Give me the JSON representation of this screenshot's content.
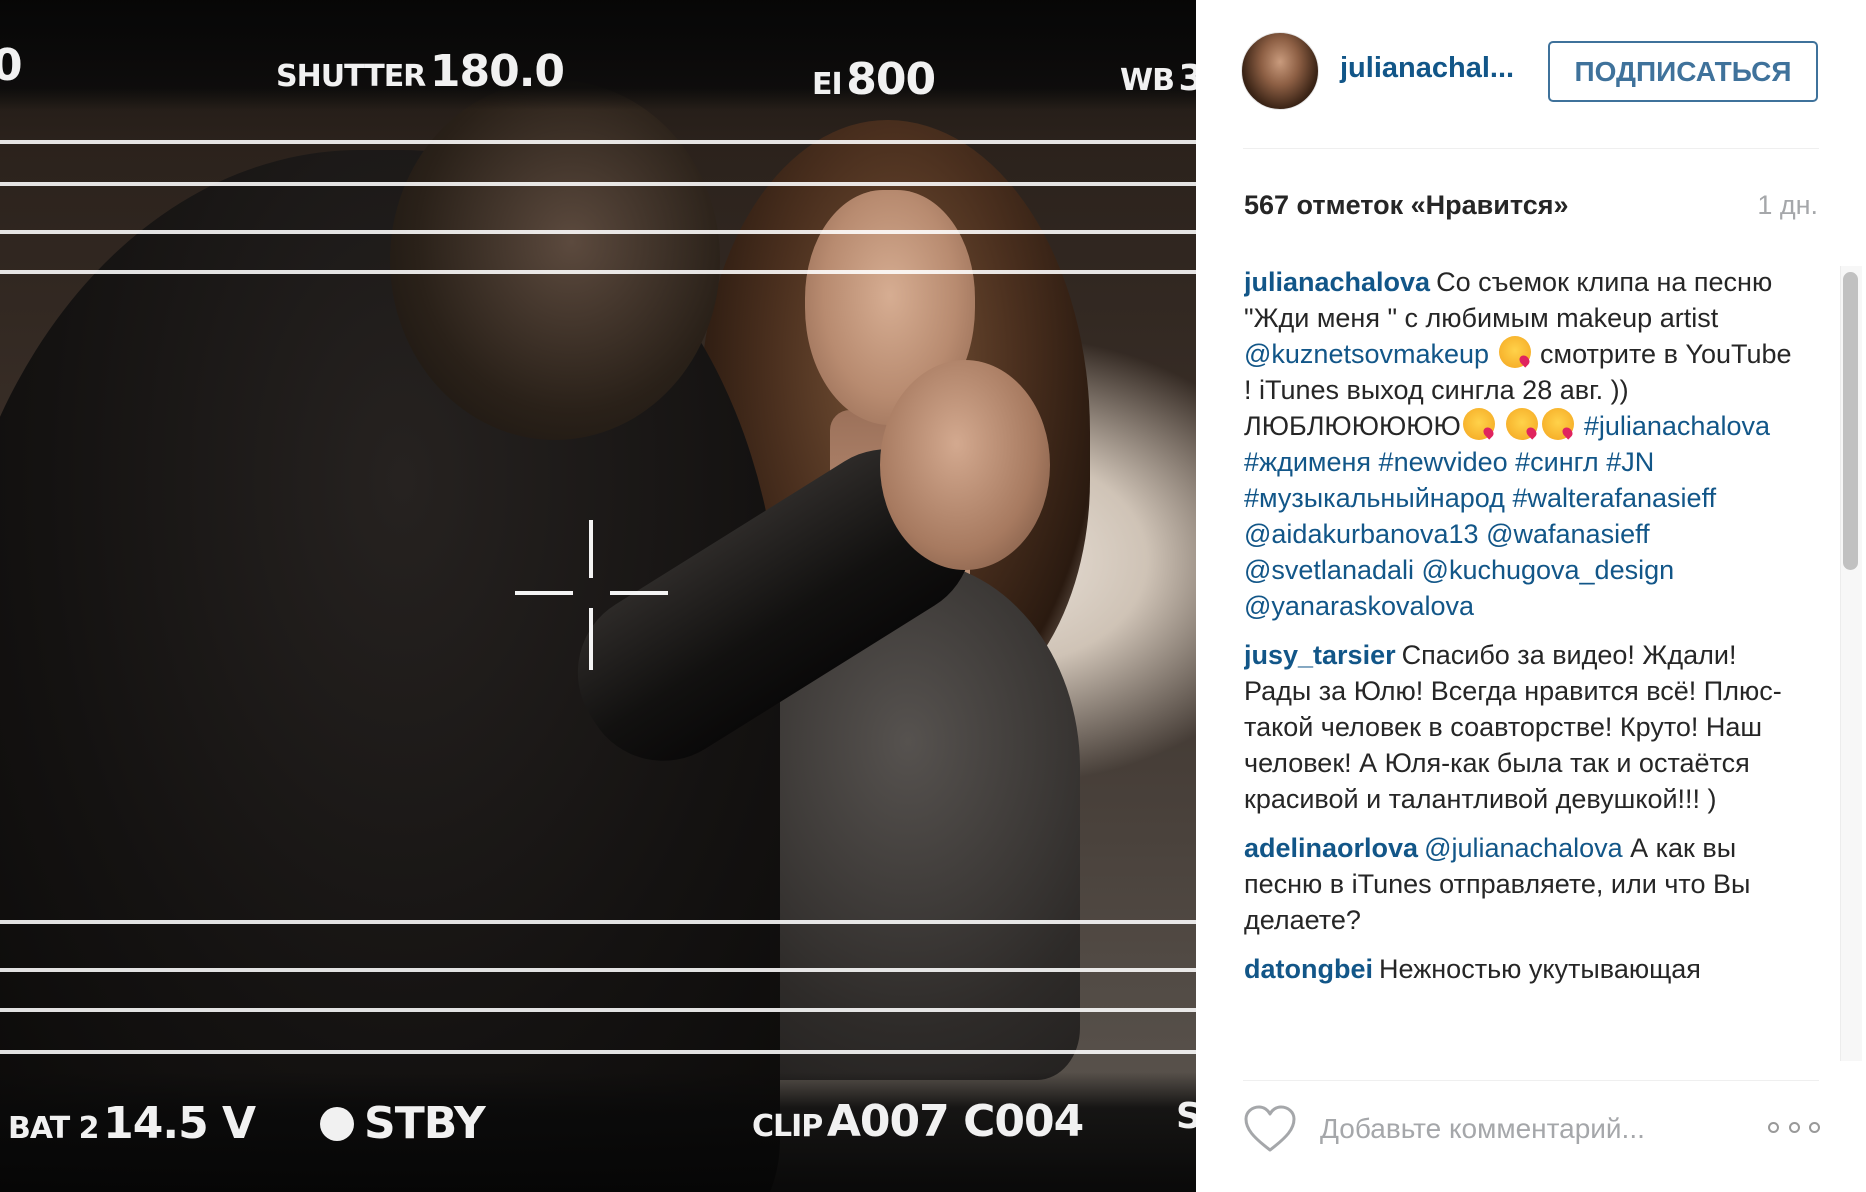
{
  "viewfinder": {
    "shutter_label": "SHUTTER",
    "shutter_value": "180.0",
    "ei_label": "EI",
    "ei_value": "800",
    "wb_label": "WB",
    "wb_value": "3",
    "left_edge_value": "0",
    "bat_label": "BAT 2",
    "bat_value": "14.5 V",
    "stby_label": "STBY",
    "clip_label": "CLIP",
    "clip_value": "A007 C004",
    "right_edge_letter": "S"
  },
  "post": {
    "username": "julianachal...",
    "follow_label": "ПОДПИСАТЬСЯ",
    "likes": "567 отметок «Нравится»",
    "time": "1 дн."
  },
  "comments": [
    {
      "user": "julianachalova",
      "parts": [
        "Со съемок клипа на песню \"Жди меня \" с любимым makeup artist ",
        "@kuznetsovmakeup",
        " ",
        "emoji",
        " смотрите в YouTube ! iTunes выход сингла 28 авг. )) ЛЮБЛЮЮЮЮЮ",
        "emoji",
        " ",
        "emoji",
        "emoji",
        " ",
        "#julianachalova",
        " ",
        "#ждименя",
        " ",
        "#newvideo",
        " ",
        "#сингл",
        " ",
        "#JN",
        " ",
        "#музыкальныйнарод",
        " ",
        "#walterafanasieff",
        " ",
        "@aidakurbanova13",
        " ",
        "@wafanasieff",
        " ",
        "@svetlanadali",
        " ",
        "@kuchugova_design",
        " ",
        "@yanaraskovalova"
      ]
    },
    {
      "user": "jusy_tarsier",
      "parts": [
        "Спасибо за видео! Ждали! Рады за Юлю! Всегда нравится всё! Плюс-такой человек в соавторстве! Круто! Наш человек! А Юля-как была так и остаётся красивой и талантливой девушкой!!! )"
      ]
    },
    {
      "user": "adelinaorlova",
      "parts": [
        "@julianachalova",
        " А как вы песню в iTunes отправляете, или что Вы делаете?"
      ]
    },
    {
      "user": "datongbei",
      "parts": [
        "Нежностью укутывающая"
      ]
    }
  ],
  "footer": {
    "comment_placeholder": "Добавьте комментарий...",
    "heart_icon": "heart-outline-icon",
    "more_icon": "more-options-icon"
  },
  "colors": {
    "link": "#125688",
    "follow_border": "#3f729b",
    "muted": "#a5a7aa"
  }
}
